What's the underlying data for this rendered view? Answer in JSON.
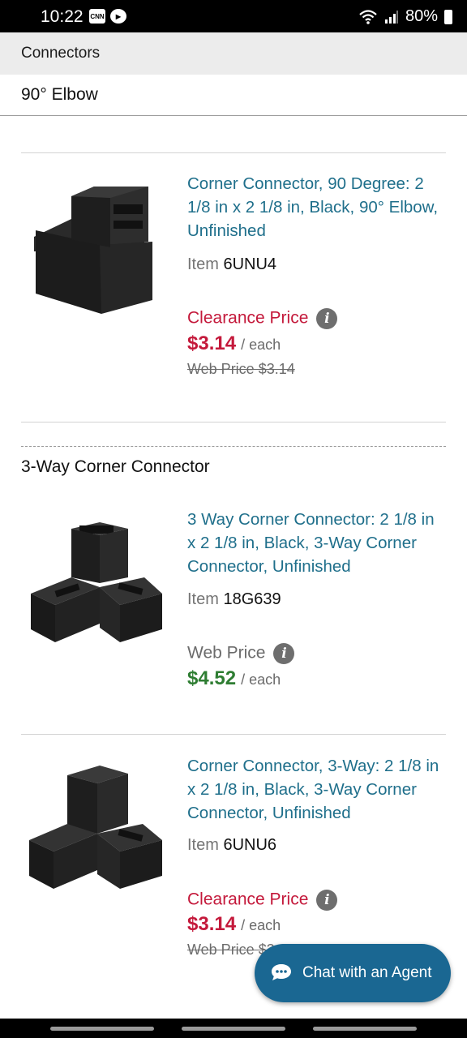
{
  "status_bar": {
    "time": "10:22",
    "battery": "80%",
    "left_icons": [
      "CNN",
      "play-icon"
    ]
  },
  "breadcrumb": "Connectors",
  "subcategory": "90° Elbow",
  "sections": [
    {
      "heading": "",
      "products": [
        {
          "title": "Corner Connector, 90 Degree: 2 1/8 in x 2 1/8 in, Black, 90° Elbow, Unfinished",
          "item_label": "Item",
          "item_number": "6UNU4",
          "price_label": "Clearance Price",
          "price": "$3.14",
          "per": "/ each",
          "old_price": "Web Price $3.14"
        }
      ]
    },
    {
      "heading": "3-Way Corner Connector",
      "products": [
        {
          "title": "3 Way Corner Connector: 2 1/8 in x 2 1/8 in, Black, 3-Way Corner Connector, Unfinished",
          "item_label": "Item",
          "item_number": "18G639",
          "price_label": "Web Price",
          "price": "$4.52",
          "per": "/ each"
        },
        {
          "title": "Corner Connector, 3-Way: 2 1/8 in x 2 1/8 in, Black, 3-Way Corner Connector, Unfinished",
          "item_label": "Item",
          "item_number": "6UNU6",
          "price_label": "Clearance Price",
          "price": "$3.14",
          "per": "/ each",
          "old_price": "Web Price $3.14"
        }
      ]
    }
  ],
  "chat_button": "Chat with an Agent",
  "colors": {
    "link": "#1f6f8b",
    "clearance": "#c4193b",
    "web_price": "#2e7d32",
    "chat_bg": "#1a6792"
  }
}
